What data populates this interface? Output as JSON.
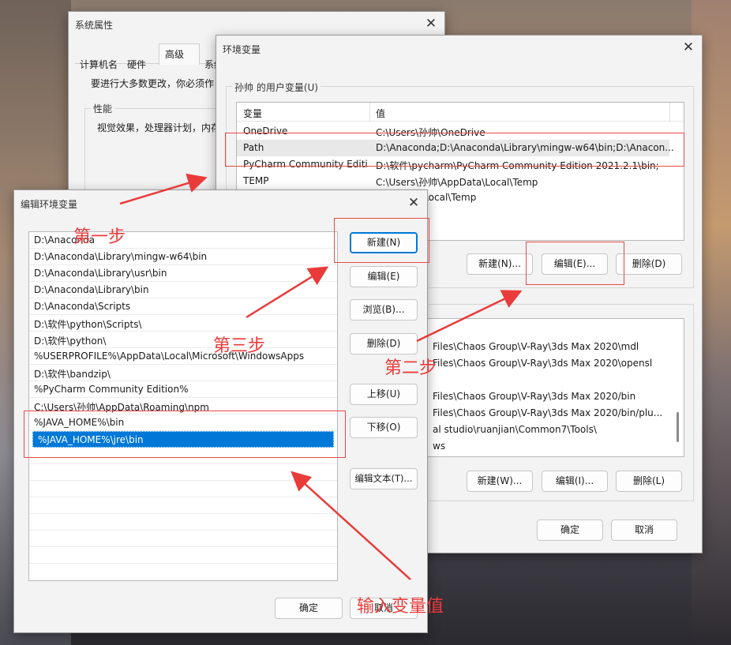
{
  "sysprops": {
    "title": "系统属性",
    "tabs": [
      "计算机名",
      "硬件",
      "高级",
      "系统"
    ],
    "intro": "要进行大多数更改，你必须作",
    "perf_label": "性能",
    "perf_text": "视觉效果，处理器计划，内存"
  },
  "envvars": {
    "title": "环境变量",
    "user_group_label": "孙帅 的用户变量(U)",
    "columns": [
      "变量",
      "值"
    ],
    "user_vars": [
      {
        "name": "OneDrive",
        "value": "C:\\Users\\孙帅\\OneDrive"
      },
      {
        "name": "Path",
        "value": "D:\\Anaconda;D:\\Anaconda\\Library\\mingw-w64\\bin;D:\\Anacon..."
      },
      {
        "name": "PyCharm Community Editi...",
        "value": "D:\\软件\\pycharm\\PyCharm Community Edition 2021.2.1\\bin;"
      },
      {
        "name": "TEMP",
        "value": "C:\\Users\\孙帅\\AppData\\Local\\Temp"
      },
      {
        "name": "",
        "value": "\\AppData\\Local\\Temp"
      }
    ],
    "user_buttons": {
      "new": "新建(N)...",
      "edit": "编辑(E)...",
      "delete": "删除(D)"
    },
    "sys_vars_partial": [
      "Files\\Chaos Group\\V-Ray\\3ds Max 2020\\mdl",
      "Files\\Chaos Group\\V-Ray\\3ds Max 2020\\opensl",
      "Files\\Chaos Group\\V-Ray\\3ds Max 2020/bin",
      "Files\\Chaos Group\\V-Ray\\3ds Max 2020/bin/plu...",
      "al studio\\ruanjian\\Common7\\Tools\\",
      "ws"
    ],
    "sys_buttons": {
      "new": "新建(W)...",
      "edit": "编辑(I)...",
      "delete": "删除(L)"
    },
    "ok": "确定",
    "cancel": "取消"
  },
  "editenv": {
    "title": "编辑环境变量",
    "entries": [
      "D:\\Anaconda",
      "D:\\Anaconda\\Library\\mingw-w64\\bin",
      "D:\\Anaconda\\Library\\usr\\bin",
      "D:\\Anaconda\\Library\\bin",
      "D:\\Anaconda\\Scripts",
      "D:\\软件\\python\\Scripts\\",
      "D:\\软件\\python\\",
      "%USERPROFILE%\\AppData\\Local\\Microsoft\\WindowsApps",
      "D:\\软件\\bandzip\\",
      "%PyCharm Community Edition%",
      "C:\\Users\\孙帅\\AppData\\Roaming\\npm",
      "%JAVA_HOME%\\bin",
      "%JAVA_HOME%\\jre\\bin"
    ],
    "selected_index": 12,
    "buttons": {
      "new": "新建(N)",
      "edit": "编辑(E)",
      "browse": "浏览(B)...",
      "delete": "删除(D)",
      "move_up": "上移(U)",
      "move_down": "下移(O)",
      "edit_text": "编辑文本(T)..."
    },
    "ok": "确定",
    "cancel": "取消"
  },
  "annotations": {
    "step1": "第一步",
    "step2": "第二步",
    "step3": "第三步",
    "input_value": "输入变量值"
  },
  "colors": {
    "accent": "#0078d7",
    "annotation_red": "#ea3b3b",
    "selected_row": "#0078d7"
  }
}
